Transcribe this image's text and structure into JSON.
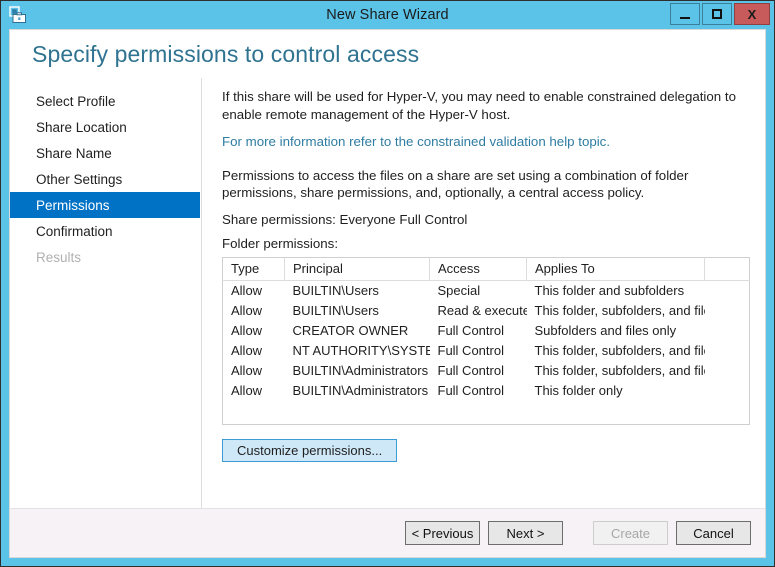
{
  "window": {
    "title": "New Share Wizard",
    "icon": "share-wizard-icon",
    "controls": {
      "minimize": "minimize-icon",
      "maximize": "maximize-icon",
      "close": "X"
    }
  },
  "header": {
    "page_title": "Specify permissions to control access"
  },
  "sidebar": {
    "items": [
      {
        "label": "Select Profile",
        "state": "normal"
      },
      {
        "label": "Share Location",
        "state": "normal"
      },
      {
        "label": "Share Name",
        "state": "normal"
      },
      {
        "label": "Other Settings",
        "state": "normal"
      },
      {
        "label": "Permissions",
        "state": "selected"
      },
      {
        "label": "Confirmation",
        "state": "normal"
      },
      {
        "label": "Results",
        "state": "disabled"
      }
    ]
  },
  "main": {
    "hyperv_note": "If this share will be used for Hyper-V, you may need to enable constrained delegation to enable remote management of the Hyper-V host.",
    "help_link": "For more information refer to the constrained validation help topic.",
    "permissions_note": "Permissions to access the files on a share are set using a combination of folder permissions, share permissions, and, optionally, a central access policy.",
    "share_permissions_line": "Share permissions: Everyone Full Control",
    "folder_permissions_label": "Folder permissions:",
    "customize_button": "Customize permissions...",
    "table": {
      "columns": [
        "Type",
        "Principal",
        "Access",
        "Applies To",
        ""
      ],
      "rows": [
        {
          "type": "Allow",
          "principal": "BUILTIN\\Users",
          "access": "Special",
          "applies_to": "This folder and subfolders"
        },
        {
          "type": "Allow",
          "principal": "BUILTIN\\Users",
          "access": "Read & execute",
          "applies_to": "This folder, subfolders, and files"
        },
        {
          "type": "Allow",
          "principal": "CREATOR OWNER",
          "access": "Full Control",
          "applies_to": "Subfolders and files only"
        },
        {
          "type": "Allow",
          "principal": "NT AUTHORITY\\SYSTEM",
          "access": "Full Control",
          "applies_to": "This folder, subfolders, and files"
        },
        {
          "type": "Allow",
          "principal": "BUILTIN\\Administrators",
          "access": "Full Control",
          "applies_to": "This folder, subfolders, and files"
        },
        {
          "type": "Allow",
          "principal": "BUILTIN\\Administrators",
          "access": "Full Control",
          "applies_to": "This folder only"
        }
      ]
    }
  },
  "footer": {
    "buttons": [
      {
        "label": "< Previous",
        "state": "enabled"
      },
      {
        "label": "Next >",
        "state": "enabled"
      },
      {
        "label": "Create",
        "state": "disabled"
      },
      {
        "label": "Cancel",
        "state": "enabled"
      }
    ]
  },
  "colors": {
    "titlebar": "#5bc3e8",
    "accent_selected": "#0072c6",
    "heading": "#2f7391",
    "link": "#2e7ca3",
    "close_button": "#c75b5b",
    "customize_fill": "#cfe8f7",
    "customize_border": "#3c9bd4"
  }
}
